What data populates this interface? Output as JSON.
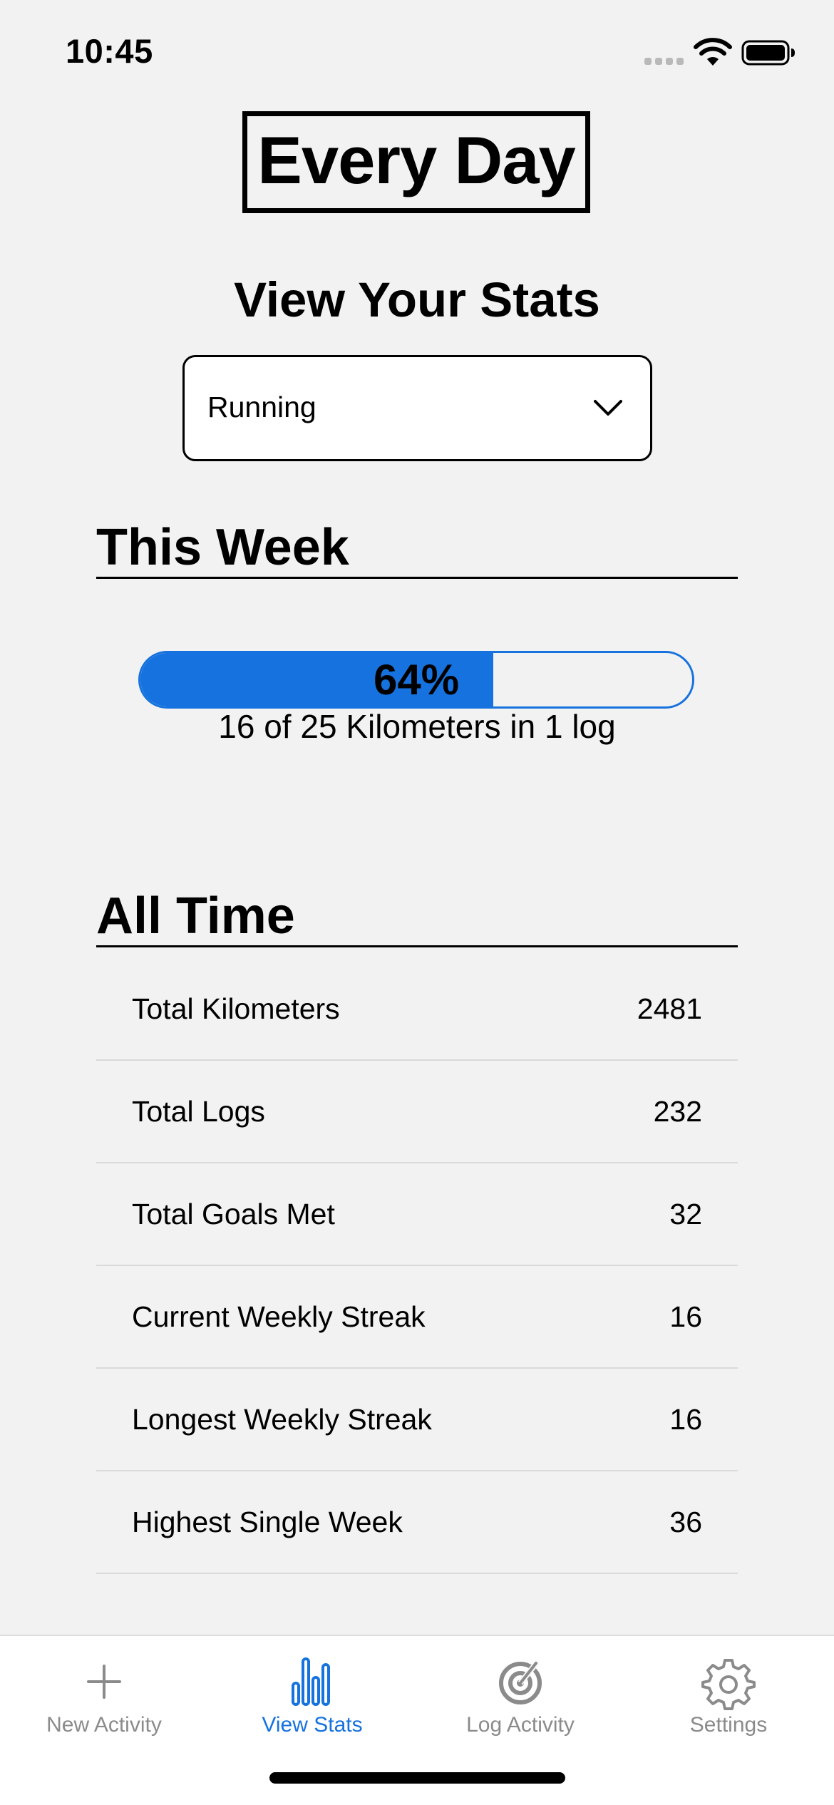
{
  "status_bar": {
    "time": "10:45"
  },
  "app": {
    "logo_text": "Every Day",
    "page_heading": "View Your Stats"
  },
  "activity_select": {
    "selected": "Running"
  },
  "this_week": {
    "title": "This Week",
    "progress_percent": 64,
    "progress_label": "64%",
    "caption": "16 of 25 Kilometers in 1 log"
  },
  "all_time": {
    "title": "All Time",
    "stats": [
      {
        "label": "Total Kilometers",
        "value": "2481"
      },
      {
        "label": "Total Logs",
        "value": "232"
      },
      {
        "label": "Total Goals Met",
        "value": "32"
      },
      {
        "label": "Current Weekly Streak",
        "value": "16"
      },
      {
        "label": "Longest Weekly Streak",
        "value": "16"
      },
      {
        "label": "Highest Single Week",
        "value": "36"
      }
    ]
  },
  "tab_bar": {
    "tabs": [
      {
        "label": "New Activity",
        "icon": "plus-icon",
        "active": false
      },
      {
        "label": "View Stats",
        "icon": "bar-chart-icon",
        "active": true
      },
      {
        "label": "Log Activity",
        "icon": "target-icon",
        "active": false
      },
      {
        "label": "Settings",
        "icon": "gear-icon",
        "active": false
      }
    ]
  },
  "colors": {
    "accent": "#1672de",
    "inactive": "#8b8b8b",
    "background": "#f2f2f2"
  }
}
